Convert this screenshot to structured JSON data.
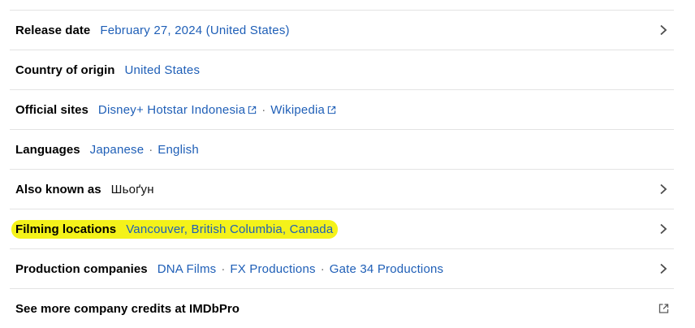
{
  "rows": [
    {
      "label": "Release date",
      "values": [
        "February 27, 2024 (United States)"
      ],
      "chevron": true
    },
    {
      "label": "Country of origin",
      "values": [
        "United States"
      ],
      "chevron": false
    },
    {
      "label": "Official sites",
      "values": [
        "Disney+ Hotstar Indonesia",
        "Wikipedia"
      ],
      "chevron": false
    },
    {
      "label": "Languages",
      "values": [
        "Japanese",
        "English"
      ],
      "chevron": false
    },
    {
      "label": "Also known as",
      "values": [
        "Шьоґун"
      ],
      "chevron": true
    },
    {
      "label": "Filming locations",
      "values": [
        "Vancouver, British Columbia, Canada"
      ],
      "chevron": true,
      "highlighted": true
    },
    {
      "label": "Production companies",
      "values": [
        "DNA Films",
        "FX Productions",
        "Gate 34 Productions"
      ],
      "chevron": true
    },
    {
      "label": "See more company credits at IMDbPro",
      "values": [],
      "external": true
    }
  ],
  "separator": "·",
  "colors": {
    "link": "#1f5fb7",
    "highlight": "#f4f21a",
    "divider": "#e3e3e3"
  },
  "icons": {
    "chevron": "chevron-right-icon",
    "external": "external-link-icon"
  }
}
